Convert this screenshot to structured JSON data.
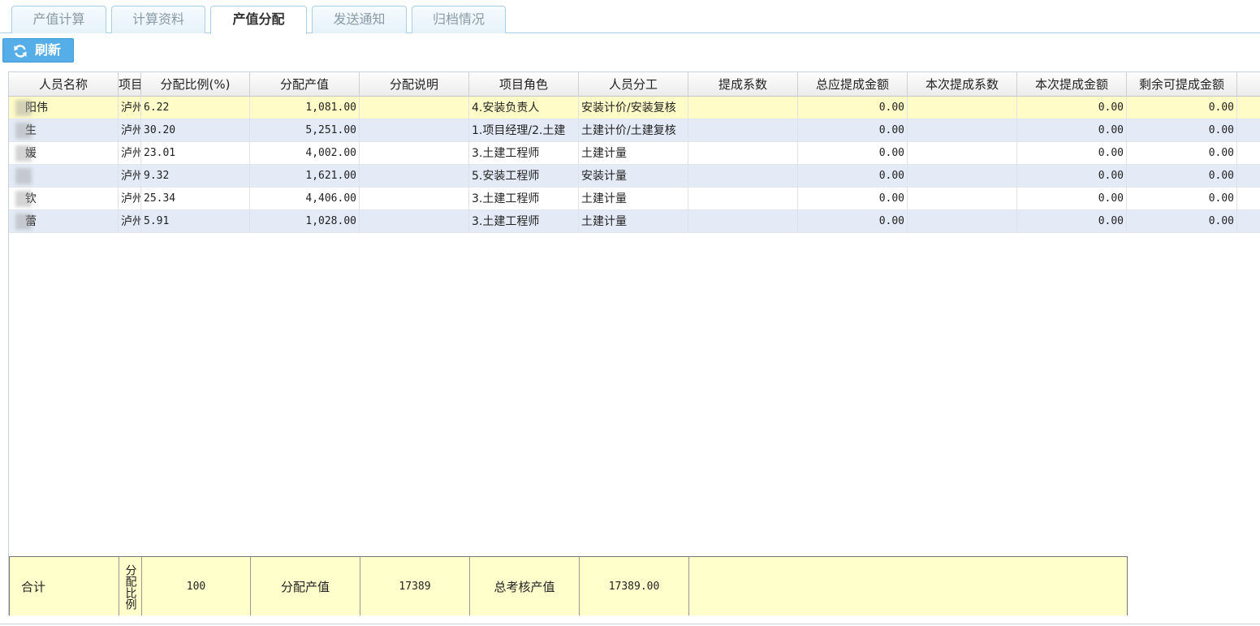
{
  "tabs": [
    "产值计算",
    "计算资料",
    "产值分配",
    "发送通知",
    "归档情况"
  ],
  "active_tab": "产值分配",
  "toolbar": {
    "refresh_label": "刷新",
    "refresh_icon": "refresh-icon",
    "accent": "#56aee8"
  },
  "grid": {
    "columns": [
      "人员名称",
      "项目",
      "分配比例(%)",
      "分配产值",
      "分配说明",
      "项目角色",
      "人员分工",
      "提成系数",
      "总应提成金额",
      "本次提成系数",
      "本次提成金额",
      "剩余可提成金额"
    ],
    "rows": [
      {
        "name": "阳伟",
        "project": "泸州",
        "ratio": "6.22",
        "value": "1,081.00",
        "desc": "",
        "role": "4.安装负责人",
        "division": "安装计价/安装复核",
        "coef": "",
        "total": "0.00",
        "cur_coef": "",
        "cur_amount": "0.00",
        "remaining": "0.00"
      },
      {
        "name": "生",
        "project": "泸州",
        "ratio": "30.20",
        "value": "5,251.00",
        "desc": "",
        "role": "1.项目经理/2.土建",
        "division": "土建计价/土建复核",
        "coef": "",
        "total": "0.00",
        "cur_coef": "",
        "cur_amount": "0.00",
        "remaining": "0.00"
      },
      {
        "name": "媛",
        "project": "泸州",
        "ratio": "23.01",
        "value": "4,002.00",
        "desc": "",
        "role": "3.土建工程师",
        "division": "土建计量",
        "coef": "",
        "total": "0.00",
        "cur_coef": "",
        "cur_amount": "0.00",
        "remaining": "0.00"
      },
      {
        "name": "",
        "project": "泸州",
        "ratio": "9.32",
        "value": "1,621.00",
        "desc": "",
        "role": "5.安装工程师",
        "division": "安装计量",
        "coef": "",
        "total": "0.00",
        "cur_coef": "",
        "cur_amount": "0.00",
        "remaining": "0.00"
      },
      {
        "name": "钦",
        "project": "泸州",
        "ratio": "25.34",
        "value": "4,406.00",
        "desc": "",
        "role": "3.土建工程师",
        "division": "土建计量",
        "coef": "",
        "total": "0.00",
        "cur_coef": "",
        "cur_amount": "0.00",
        "remaining": "0.00"
      },
      {
        "name": "蕾",
        "project": "泸州",
        "ratio": "5.91",
        "value": "1,028.00",
        "desc": "",
        "role": "3.土建工程师",
        "division": "土建计量",
        "coef": "",
        "total": "0.00",
        "cur_coef": "",
        "cur_amount": "0.00",
        "remaining": "0.00"
      }
    ]
  },
  "footer": {
    "total_label": "合计",
    "ratio_label": "分配比例",
    "ratio_value": "100",
    "value_label": "分配产值",
    "value_value": "17389",
    "assess_label": "总考核产值",
    "assess_value": "17389.00"
  }
}
